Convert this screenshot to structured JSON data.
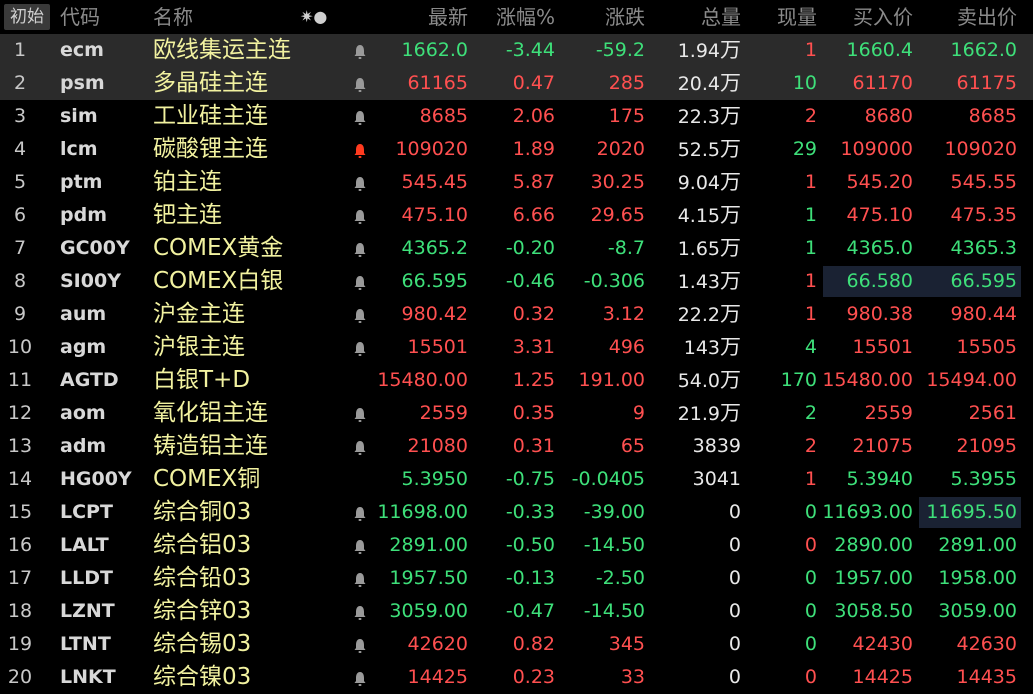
{
  "header": {
    "init_button": "初始",
    "col_code": "代码",
    "col_name": "名称",
    "col_icons": "✷●",
    "col_last": "最新",
    "col_pct": "涨幅%",
    "col_chg": "涨跌",
    "col_vol": "总量",
    "col_cur": "现量",
    "col_bid": "买入价",
    "col_ask": "卖出价"
  },
  "colors": {
    "up": "#ff5050",
    "down": "#3ee07a",
    "flat": "#e0e0e0",
    "name": "#f2f2a0"
  },
  "rows": [
    {
      "idx": "1",
      "code": "ecm",
      "name": "欧线集运主连",
      "bell": "normal",
      "last": "1662.0",
      "pct": "-3.44",
      "chg": "-59.2",
      "vol": "1.94",
      "vol_unit": "万",
      "cur": "1",
      "bid": "1660.4",
      "ask": "1662.0",
      "dir": "down",
      "cur_dir": "up",
      "bid_dir": "down",
      "ask_dir": "down",
      "highlight": true
    },
    {
      "idx": "2",
      "code": "psm",
      "name": "多晶硅主连",
      "bell": "normal",
      "last": "61165",
      "pct": "0.47",
      "chg": "285",
      "vol": "20.4",
      "vol_unit": "万",
      "cur": "10",
      "bid": "61170",
      "ask": "61175",
      "dir": "up",
      "cur_dir": "down",
      "bid_dir": "up",
      "ask_dir": "up",
      "highlight": true
    },
    {
      "idx": "3",
      "code": "sim",
      "name": "工业硅主连",
      "bell": "normal",
      "last": "8685",
      "pct": "2.06",
      "chg": "175",
      "vol": "22.3",
      "vol_unit": "万",
      "cur": "2",
      "bid": "8680",
      "ask": "8685",
      "dir": "up",
      "cur_dir": "up",
      "bid_dir": "up",
      "ask_dir": "up"
    },
    {
      "idx": "4",
      "code": "lcm",
      "name": "碳酸锂主连",
      "bell": "alert",
      "last": "109020",
      "pct": "1.89",
      "chg": "2020",
      "vol": "52.5",
      "vol_unit": "万",
      "cur": "29",
      "bid": "109000",
      "ask": "109020",
      "dir": "up",
      "cur_dir": "down",
      "bid_dir": "up",
      "ask_dir": "up"
    },
    {
      "idx": "5",
      "code": "ptm",
      "name": "铂主连",
      "bell": "normal",
      "last": "545.45",
      "pct": "5.87",
      "chg": "30.25",
      "vol": "9.04",
      "vol_unit": "万",
      "cur": "1",
      "bid": "545.20",
      "ask": "545.55",
      "dir": "up",
      "cur_dir": "up",
      "bid_dir": "up",
      "ask_dir": "up"
    },
    {
      "idx": "6",
      "code": "pdm",
      "name": "钯主连",
      "bell": "normal",
      "last": "475.10",
      "pct": "6.66",
      "chg": "29.65",
      "vol": "4.15",
      "vol_unit": "万",
      "cur": "1",
      "bid": "475.10",
      "ask": "475.35",
      "dir": "up",
      "cur_dir": "down",
      "bid_dir": "up",
      "ask_dir": "up"
    },
    {
      "idx": "7",
      "code": "GC00Y",
      "name": "COMEX黄金",
      "bell": "normal",
      "last": "4365.2",
      "pct": "-0.20",
      "chg": "-8.7",
      "vol": "1.65",
      "vol_unit": "万",
      "cur": "1",
      "bid": "4365.0",
      "ask": "4365.3",
      "dir": "down",
      "cur_dir": "down",
      "bid_dir": "down",
      "ask_dir": "down"
    },
    {
      "idx": "8",
      "code": "SI00Y",
      "name": "COMEX白银",
      "bell": "normal",
      "last": "66.595",
      "pct": "-0.46",
      "chg": "-0.306",
      "vol": "1.43",
      "vol_unit": "万",
      "cur": "1",
      "bid": "66.580",
      "ask": "66.595",
      "dir": "down",
      "cur_dir": "up",
      "bid_dir": "down",
      "ask_dir": "down",
      "box": "bidask"
    },
    {
      "idx": "9",
      "code": "aum",
      "name": "沪金主连",
      "bell": "normal",
      "last": "980.42",
      "pct": "0.32",
      "chg": "3.12",
      "vol": "22.2",
      "vol_unit": "万",
      "cur": "1",
      "bid": "980.38",
      "ask": "980.44",
      "dir": "up",
      "cur_dir": "up",
      "bid_dir": "up",
      "ask_dir": "up"
    },
    {
      "idx": "10",
      "code": "agm",
      "name": "沪银主连",
      "bell": "normal",
      "last": "15501",
      "pct": "3.31",
      "chg": "496",
      "vol": "143",
      "vol_unit": "万",
      "cur": "4",
      "bid": "15501",
      "ask": "15505",
      "dir": "up",
      "cur_dir": "down",
      "bid_dir": "up",
      "ask_dir": "up"
    },
    {
      "idx": "11",
      "code": "AGTD",
      "name": "白银T+D",
      "bell": "none",
      "last": "15480.00",
      "pct": "1.25",
      "chg": "191.00",
      "vol": "54.0",
      "vol_unit": "万",
      "cur": "170",
      "bid": "15480.00",
      "ask": "15494.00",
      "dir": "up",
      "cur_dir": "down",
      "bid_dir": "up",
      "ask_dir": "up"
    },
    {
      "idx": "12",
      "code": "aom",
      "name": "氧化铝主连",
      "bell": "normal",
      "last": "2559",
      "pct": "0.35",
      "chg": "9",
      "vol": "21.9",
      "vol_unit": "万",
      "cur": "2",
      "bid": "2559",
      "ask": "2561",
      "dir": "up",
      "cur_dir": "down",
      "bid_dir": "up",
      "ask_dir": "up"
    },
    {
      "idx": "13",
      "code": "adm",
      "name": "铸造铝主连",
      "bell": "normal",
      "last": "21080",
      "pct": "0.31",
      "chg": "65",
      "vol": "3839",
      "vol_unit": "",
      "cur": "2",
      "bid": "21075",
      "ask": "21095",
      "dir": "up",
      "cur_dir": "up",
      "bid_dir": "up",
      "ask_dir": "up"
    },
    {
      "idx": "14",
      "code": "HG00Y",
      "name": "COMEX铜",
      "bell": "none",
      "last": "5.3950",
      "pct": "-0.75",
      "chg": "-0.0405",
      "vol": "3041",
      "vol_unit": "",
      "cur": "1",
      "bid": "5.3940",
      "ask": "5.3955",
      "dir": "down",
      "cur_dir": "up",
      "bid_dir": "down",
      "ask_dir": "down"
    },
    {
      "idx": "15",
      "code": "LCPT",
      "name": "综合铜03",
      "bell": "normal",
      "last": "11698.00",
      "pct": "-0.33",
      "chg": "-39.00",
      "vol": "0",
      "vol_unit": "",
      "cur": "0",
      "bid": "11693.00",
      "ask": "11695.50",
      "dir": "down",
      "cur_dir": "down",
      "bid_dir": "down",
      "ask_dir": "down",
      "box": "ask"
    },
    {
      "idx": "16",
      "code": "LALT",
      "name": "综合铝03",
      "bell": "normal",
      "last": "2891.00",
      "pct": "-0.50",
      "chg": "-14.50",
      "vol": "0",
      "vol_unit": "",
      "cur": "0",
      "bid": "2890.00",
      "ask": "2891.00",
      "dir": "down",
      "cur_dir": "up",
      "bid_dir": "down",
      "ask_dir": "down"
    },
    {
      "idx": "17",
      "code": "LLDT",
      "name": "综合铅03",
      "bell": "normal",
      "last": "1957.50",
      "pct": "-0.13",
      "chg": "-2.50",
      "vol": "0",
      "vol_unit": "",
      "cur": "0",
      "bid": "1957.00",
      "ask": "1958.00",
      "dir": "down",
      "cur_dir": "down",
      "bid_dir": "down",
      "ask_dir": "down"
    },
    {
      "idx": "18",
      "code": "LZNT",
      "name": "综合锌03",
      "bell": "normal",
      "last": "3059.00",
      "pct": "-0.47",
      "chg": "-14.50",
      "vol": "0",
      "vol_unit": "",
      "cur": "0",
      "bid": "3058.50",
      "ask": "3059.00",
      "dir": "down",
      "cur_dir": "down",
      "bid_dir": "down",
      "ask_dir": "down"
    },
    {
      "idx": "19",
      "code": "LTNT",
      "name": "综合锡03",
      "bell": "normal",
      "last": "42620",
      "pct": "0.82",
      "chg": "345",
      "vol": "0",
      "vol_unit": "",
      "cur": "0",
      "bid": "42430",
      "ask": "42630",
      "dir": "up",
      "cur_dir": "down",
      "bid_dir": "up",
      "ask_dir": "up"
    },
    {
      "idx": "20",
      "code": "LNKT",
      "name": "综合镍03",
      "bell": "normal",
      "last": "14425",
      "pct": "0.23",
      "chg": "33",
      "vol": "0",
      "vol_unit": "",
      "cur": "0",
      "bid": "14425",
      "ask": "14435",
      "dir": "up",
      "cur_dir": "up",
      "bid_dir": "up",
      "ask_dir": "up"
    }
  ]
}
